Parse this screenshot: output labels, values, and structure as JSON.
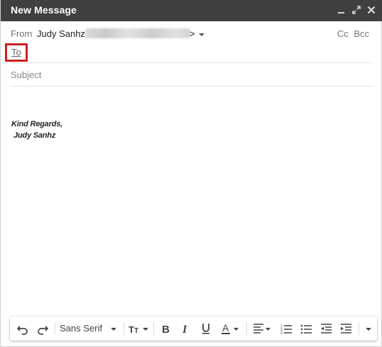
{
  "window": {
    "title": "New Message",
    "controls": [
      "minimize-icon",
      "expand-icon",
      "close-icon"
    ]
  },
  "from": {
    "label": "From",
    "name": "Judy Sanhz",
    "email_suffix": ">"
  },
  "recipients": {
    "cc_label": "Cc",
    "bcc_label": "Bcc",
    "to_label": "To"
  },
  "subject": {
    "placeholder": "Subject",
    "value": ""
  },
  "body": {
    "signature_line1": "Kind Regards,",
    "signature_line2": "Judy Sanhz"
  },
  "toolbar": {
    "font_name": "Sans Serif",
    "icons": [
      "undo-icon",
      "redo-icon",
      "font-size-icon",
      "bold-icon",
      "italic-icon",
      "underline-icon",
      "text-color-icon",
      "align-icon",
      "numbered-list-icon",
      "bulleted-list-icon",
      "indent-less-icon",
      "indent-more-icon",
      "more-formatting-icon"
    ]
  },
  "colors": {
    "titlebar": "#404040",
    "highlight": "#cc1f1f"
  }
}
